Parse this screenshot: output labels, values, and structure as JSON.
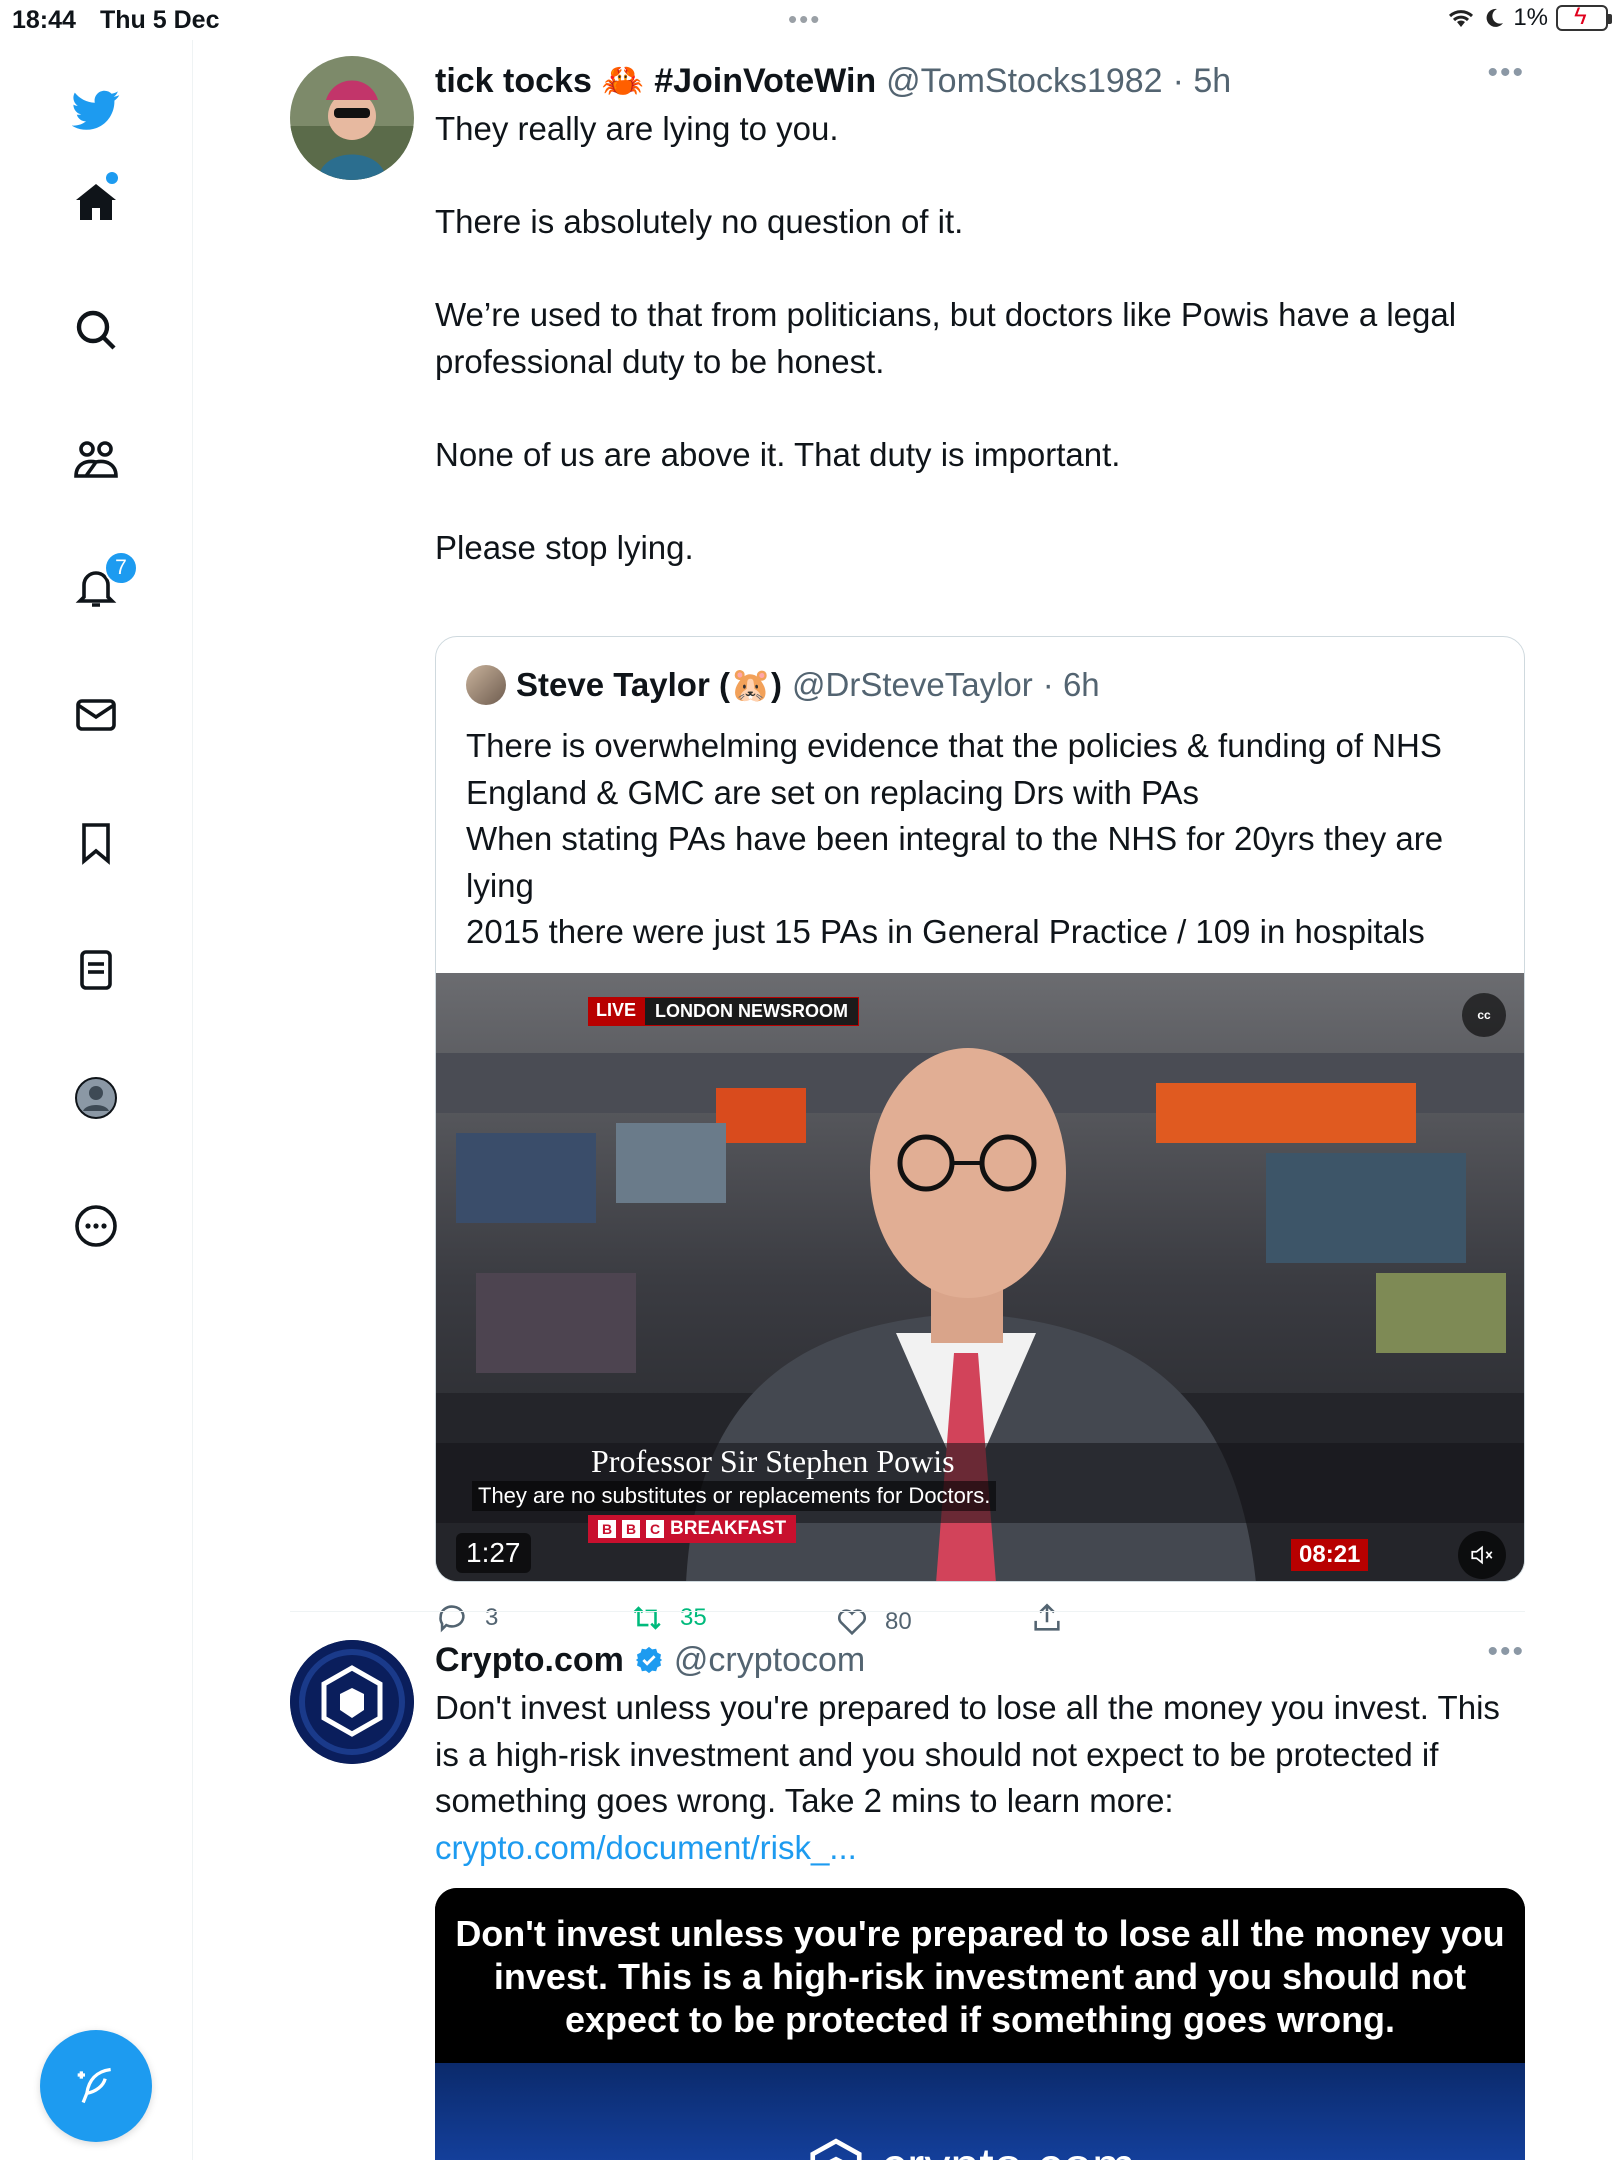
{
  "status_bar": {
    "time": "18:44",
    "date": "Thu 5 Dec",
    "battery": "1%"
  },
  "sidebar": {
    "notification_count": "7",
    "items": [
      "twitter-logo",
      "home",
      "explore",
      "communities",
      "notifications",
      "messages",
      "bookmarks",
      "lists",
      "profile",
      "more"
    ]
  },
  "tweet1": {
    "name": "tick tocks",
    "emoji": "🦀",
    "name_suffix": "#JoinVoteWin",
    "handle": "@TomStocks1982",
    "time": "· 5h",
    "more": "•••",
    "text": "They really are lying to you.\n\nThere is absolutely no question of it.\n\nWe’re used to that from politicians, but doctors like Powis have a legal professional duty to be honest.\n\nNone of us are above it. That duty is important.\n\nPlease stop lying.",
    "quote": {
      "name": "Steve Taylor (🐹)",
      "handle": "@DrSteveTaylor",
      "time": "· 6h",
      "text": "There is overwhelming evidence that the policies & funding of NHS England & GMC are set on replacing Drs with PAs\nWhen stating PAs have been integral to the NHS for 20yrs they are lying\n2015 there were just 15 PAs in General Practice / 109 in hospitals",
      "video": {
        "live_label": "LIVE",
        "newsroom_label": "LONDON NEWSROOM",
        "cc_label": "cc",
        "caption_name": "Professor Sir Stephen Powis",
        "subtitle": "They are no substitutes or replacements for Doctors.",
        "channel_b1": "B",
        "channel_b2": "B",
        "channel_c": "C",
        "channel_label": "BREAKFAST",
        "duration": "1:27",
        "clock": "08:21"
      }
    },
    "replies": "3",
    "retweets": "35",
    "likes": "80"
  },
  "tweet2": {
    "name": "Crypto.com",
    "handle": "@cryptocom",
    "more": "•••",
    "text": "Don't invest unless you're prepared to lose all the money you invest. This is a high-risk investment and you should not expect to be protected if something goes wrong. Take 2 mins to learn more:",
    "link": "crypto.com/document/risk_...",
    "card_text": "Don't invest unless you're prepared to lose all the money you invest. This is a high-risk investment and you should not expect to be protected if something goes wrong.",
    "card_logo": "crypto.com"
  },
  "colors": {
    "accent": "#1d9bf0",
    "retweet": "#00ba7c",
    "muted": "#536471"
  }
}
